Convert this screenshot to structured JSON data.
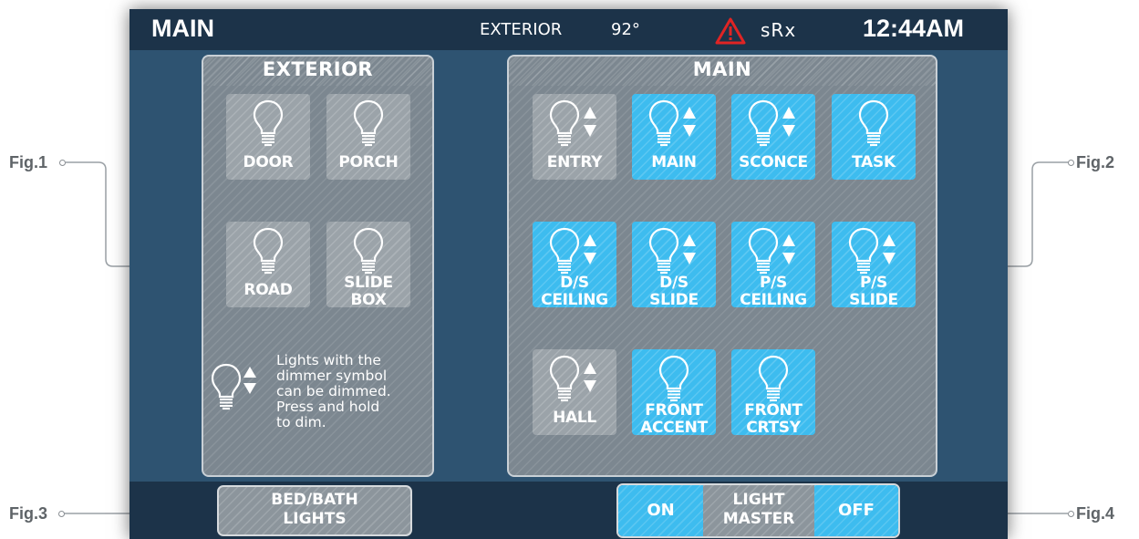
{
  "figures": {
    "fig1": "Fig.1",
    "fig2": "Fig.2",
    "fig3": "Fig.3",
    "fig4": "Fig.4"
  },
  "topbar": {
    "title": "MAIN",
    "exterior_label": "EXTERIOR",
    "exterior_temp": "92°",
    "warning_icon": "warning-triangle-icon",
    "status_text": "sRx",
    "clock": "12:44AM"
  },
  "exterior_panel": {
    "title": "EXTERIOR",
    "tiles": [
      {
        "label": "DOOR",
        "state": "off",
        "dimmable": false
      },
      {
        "label": "PORCH",
        "state": "off",
        "dimmable": false
      },
      {
        "label_line1": "ROAD",
        "state": "off",
        "dimmable": false
      },
      {
        "label_line1": "SLIDE",
        "label_line2": "BOX",
        "state": "off",
        "dimmable": false
      }
    ],
    "legend": {
      "line1": "Lights with the",
      "line2": "dimmer symbol",
      "line3": "can be dimmed.",
      "line4": "Press and hold",
      "line5": "to dim."
    }
  },
  "main_panel": {
    "title": "MAIN",
    "tiles": [
      {
        "label": "ENTRY",
        "state": "off",
        "dimmable": true
      },
      {
        "label": "MAIN",
        "state": "on",
        "dimmable": true
      },
      {
        "label": "SCONCE",
        "state": "on",
        "dimmable": true
      },
      {
        "label": "TASK",
        "state": "on",
        "dimmable": false
      },
      {
        "label_line1": "D/S",
        "label_line2": "CEILING",
        "state": "on",
        "dimmable": true
      },
      {
        "label_line1": "D/S",
        "label_line2": "SLIDE",
        "state": "on",
        "dimmable": true
      },
      {
        "label_line1": "P/S",
        "label_line2": "CEILING",
        "state": "on",
        "dimmable": true
      },
      {
        "label_line1": "P/S",
        "label_line2": "SLIDE",
        "state": "on",
        "dimmable": true
      },
      {
        "label": "HALL",
        "state": "off",
        "dimmable": true
      },
      {
        "label_line1": "FRONT",
        "label_line2": "ACCENT",
        "state": "on",
        "dimmable": false
      },
      {
        "label_line1": "FRONT",
        "label_line2": "CRTSY",
        "state": "on",
        "dimmable": false
      }
    ]
  },
  "bottombar": {
    "bedbath_line1": "BED/BATH",
    "bedbath_line2": "LIGHTS",
    "master_on": "ON",
    "master_line1": "LIGHT",
    "master_line2": "MASTER",
    "master_off": "OFF"
  },
  "colors": {
    "screen_bg": "#2e5371",
    "bar_bg": "#1c3349",
    "tile_on": "#3dbcef",
    "tile_off": "#9ba3a9",
    "warning": "#e02424"
  }
}
